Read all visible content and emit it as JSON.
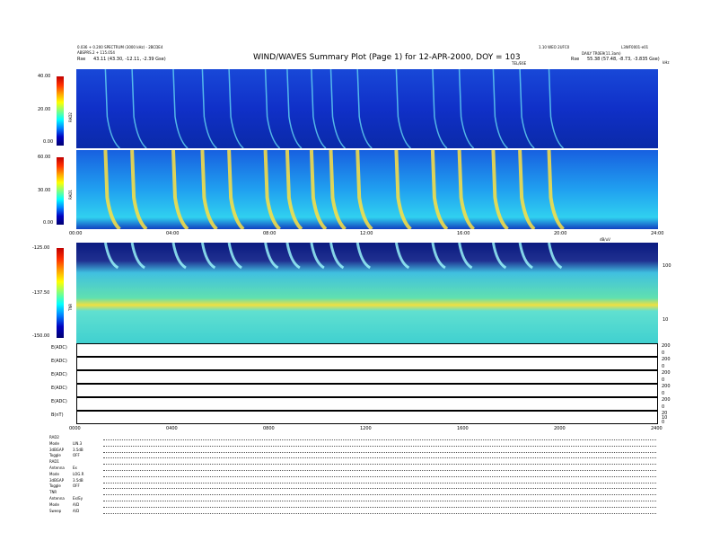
{
  "header": {
    "left_line1": "0.036 + 0.200 SPECTRUM (3000 kHz) - 2BCDE4",
    "left_line2": "ABSPRS.2 + 115.054",
    "left_line3_label": "Rse",
    "left_line3_value": "43.11 (43.30, -12.11, -2.39 Gse)",
    "title": "WIND/WAVES Summary Plot (Page 1) for 12-APR-2000, DOY = 103",
    "subtitle": "TEL/E6E",
    "right_line1": "1.10 WEO 2UFC0",
    "right_line1b": "L3WF0001-e01",
    "right_line2": "DAILY TR0E9(11.3am)",
    "right_line3_label": "Rse",
    "right_line3_value": "55.38 (57.48, -8.73, -3.835 Gse)",
    "corner_unit": "kHz"
  },
  "panels": {
    "rad2": {
      "label": "RAD2",
      "cbar_ticks": [
        "40.00",
        "20.00",
        "0.00"
      ]
    },
    "rad1": {
      "label": "RAD1",
      "cbar_ticks": [
        "60.00",
        "30.00",
        "0.00"
      ]
    },
    "tnr": {
      "label": "TNR",
      "cbar_ticks": [
        "-125.00",
        "-137.50",
        "-150.00"
      ],
      "right_ticks": [
        "100",
        "10"
      ],
      "corner": "dB/uV"
    },
    "time_ticks_top": [
      "00:00",
      "04:00",
      "08:00",
      "12:00",
      "16:00",
      "20:00",
      "24:00"
    ],
    "time_ticks_bottom": [
      "0000",
      "0400",
      "0800",
      "1200",
      "1600",
      "2000",
      "2400"
    ]
  },
  "line_plots": [
    {
      "label": "E(ADC)",
      "ticks": [
        "200",
        "0"
      ]
    },
    {
      "label": "E(ADC)",
      "ticks": [
        "200",
        "0"
      ]
    },
    {
      "label": "E(ADC)",
      "ticks": [
        "200",
        "0"
      ]
    },
    {
      "label": "E(ADC)",
      "ticks": [
        "200",
        "0"
      ]
    },
    {
      "label": "E(ADC)",
      "ticks": [
        "200",
        "0"
      ]
    },
    {
      "label": "B(nT)",
      "ticks": [
        "20",
        "10",
        "0"
      ]
    }
  ],
  "info_rows": [
    {
      "label": "RAD2",
      "value": ""
    },
    {
      "label": "Mode",
      "value": "LIN.3"
    },
    {
      "label": "3dBGAP",
      "value": "3.5dB"
    },
    {
      "label": "Toggle",
      "value": "OFF"
    },
    {
      "label": "RAD1",
      "value": ""
    },
    {
      "label": "Antenna",
      "value": "Ex"
    },
    {
      "label": "Mode",
      "value": "LOG.R"
    },
    {
      "label": "3dBGAP",
      "value": "3.5dB"
    },
    {
      "label": "Toggle",
      "value": "OFF"
    },
    {
      "label": "TNR",
      "value": ""
    },
    {
      "label": "Antenna",
      "value": "Ex/Ey"
    },
    {
      "label": "Mode",
      "value": "A/D"
    },
    {
      "label": "Sweep",
      "value": "A/D"
    }
  ],
  "chart_data": {
    "type": "heatmap",
    "title": "WIND/WAVES Summary Plot (Page 1) for 12-APR-2000, DOY = 103",
    "x_range_hours": [
      0,
      24
    ],
    "x_ticks": [
      "00:00",
      "04:00",
      "08:00",
      "12:00",
      "16:00",
      "20:00",
      "24:00"
    ],
    "panels": [
      {
        "name": "RAD2",
        "colorbar_range": [
          0,
          40
        ]
      },
      {
        "name": "RAD1",
        "colorbar_range": [
          0,
          60
        ]
      },
      {
        "name": "TNR",
        "colorbar_range": [
          -150,
          -125
        ]
      }
    ],
    "type_iii_bursts_hours": [
      1.2,
      2.3,
      4.0,
      5.2,
      6.3,
      7.8,
      8.7,
      9.7,
      10.5,
      11.6,
      13.2,
      14.7,
      15.8,
      17.2,
      18.3,
      19.5
    ]
  }
}
